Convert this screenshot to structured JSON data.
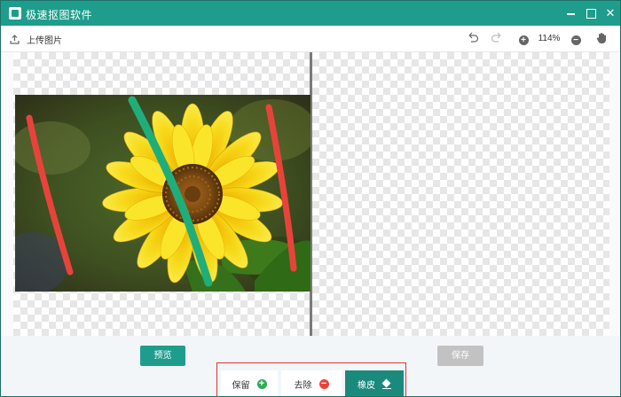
{
  "app": {
    "title": "极速抠图软件"
  },
  "window_controls": {
    "minimize": "minimize-icon",
    "maximize": "maximize-icon",
    "close": "close-icon"
  },
  "toolbar": {
    "upload_label": "上传图片",
    "zoom_level": "114%",
    "icons": [
      "upload-icon",
      "undo-icon",
      "redo-icon",
      "zoom-in-icon",
      "zoom-out-icon",
      "hand-icon"
    ]
  },
  "canvas": {
    "stroke_colors": {
      "remove": "#e8433b",
      "keep": "#1fae7a"
    }
  },
  "actions": {
    "preview_label": "预览",
    "save_label": "保存"
  },
  "modes": {
    "keep_label": "保留",
    "remove_label": "去除",
    "eraser_label": "橡皮"
  },
  "colors": {
    "accent": "#1f9d8c",
    "disabled": "#c2c2c2",
    "highlight_box": "#e0312b"
  }
}
